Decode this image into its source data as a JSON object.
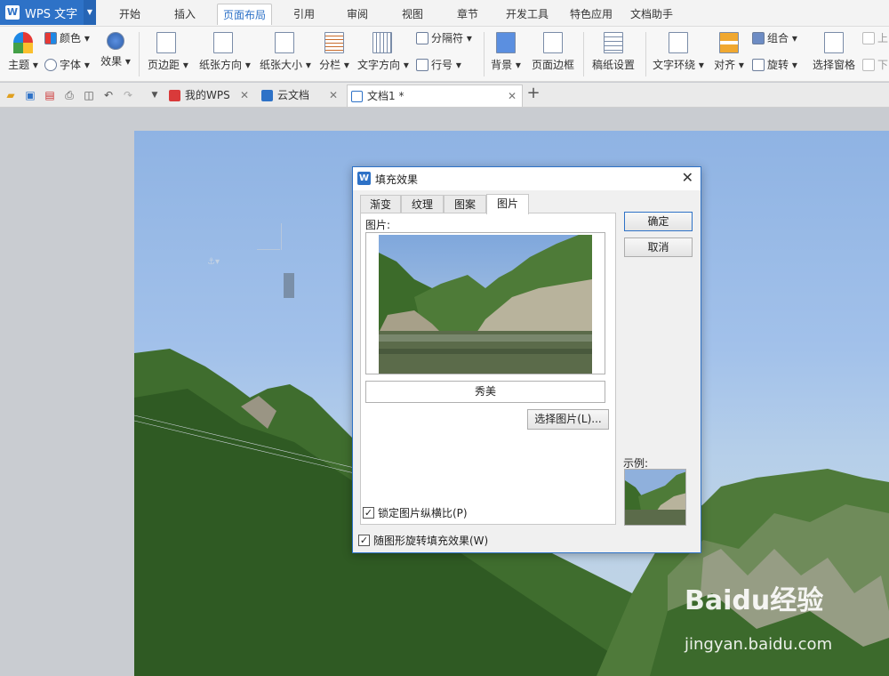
{
  "app": {
    "name": "WPS 文字",
    "logo_letter": "W",
    "accent_color": "#2e72c7"
  },
  "menu_tabs": [
    {
      "label": "开始"
    },
    {
      "label": "插入"
    },
    {
      "label": "页面布局",
      "active": true
    },
    {
      "label": "引用"
    },
    {
      "label": "审阅"
    },
    {
      "label": "视图"
    },
    {
      "label": "章节"
    },
    {
      "label": "开发工具"
    },
    {
      "label": "特色应用"
    },
    {
      "label": "文档助手"
    }
  ],
  "ribbon": {
    "theme": "主题 ▾",
    "color": "颜色 ▾",
    "font": "字体 ▾",
    "effect": "效果 ▾",
    "margins": "页边距 ▾",
    "orientation": "纸张方向 ▾",
    "size": "纸张大小 ▾",
    "columns": "分栏 ▾",
    "text_direction": "文字方向 ▾",
    "separator": "分隔符 ▾",
    "line_number": "行号 ▾",
    "background": "背景 ▾",
    "page_border": "页面边框",
    "manuscript": "稿纸设置",
    "wrap_text": "文字环绕 ▾",
    "align": "对齐 ▾",
    "group": "组合 ▾",
    "rotate": "旋转 ▾",
    "selection_pane": "选择窗格",
    "bring_forward": "上",
    "send_backward": "下"
  },
  "doc_tabs": [
    {
      "label": "我的WPS",
      "icon": "wps-icon"
    },
    {
      "label": "云文档",
      "icon": "cloud-icon"
    },
    {
      "label": "文档1 *",
      "icon": "document-icon",
      "active": true
    }
  ],
  "dialog": {
    "title": "填充效果",
    "tabs": [
      "渐变",
      "纹理",
      "图案",
      "图片"
    ],
    "active_tab": "图片",
    "picture_label": "图片:",
    "picture_name": "秀美",
    "select_picture_button": "选择图片(L)...",
    "lock_aspect_label": "锁定图片纵横比(P)",
    "lock_aspect_checked": true,
    "rotate_with_shape_label": "随图形旋转填充效果(W)",
    "rotate_with_shape_checked": true,
    "ok_button": "确定",
    "cancel_button": "取消",
    "sample_label": "示例:"
  },
  "watermark": {
    "brand": "Baidu经验",
    "url": "jingyan.baidu.com"
  }
}
